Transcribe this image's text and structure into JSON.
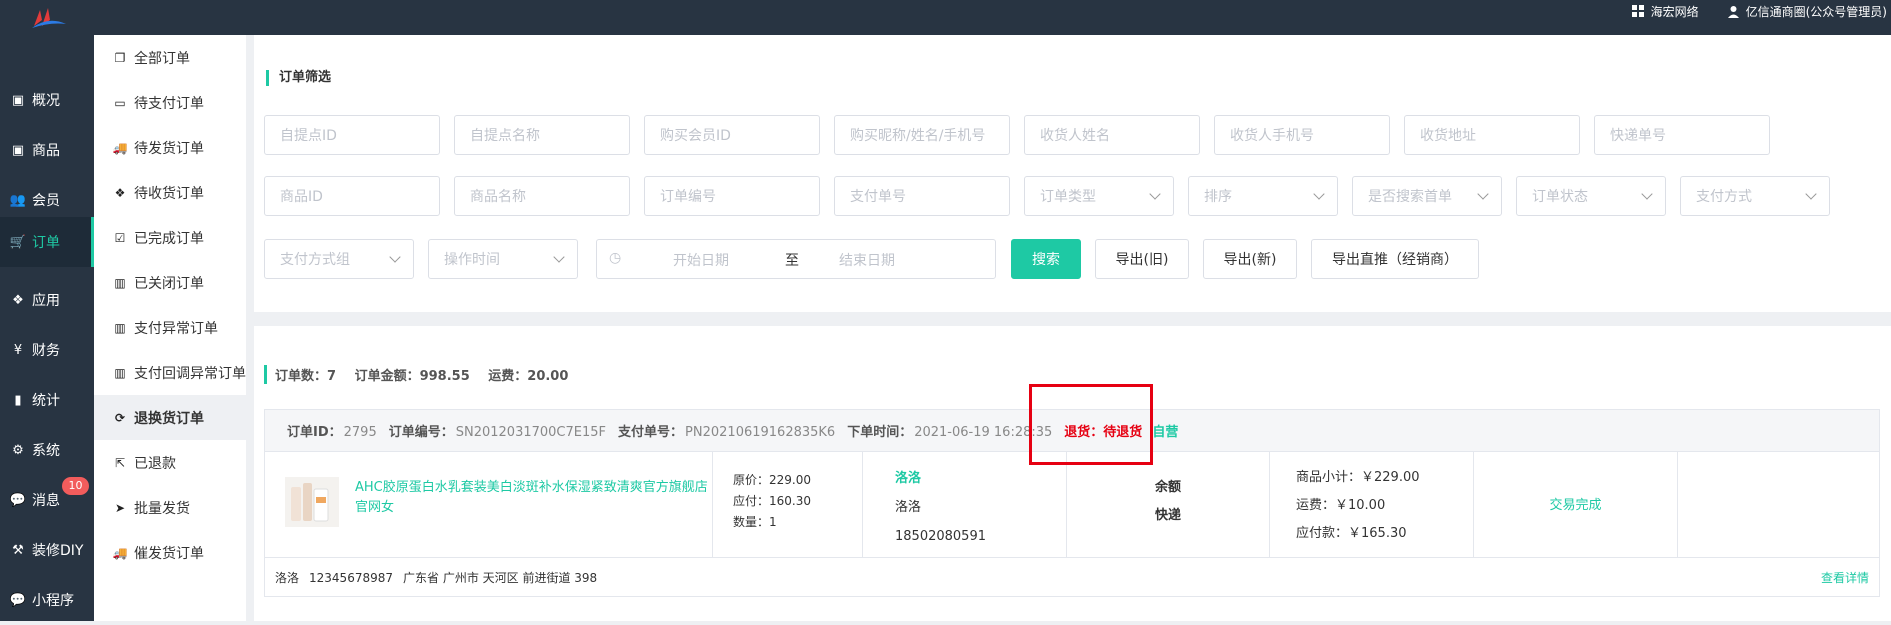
{
  "header": {
    "org": "海宏网络",
    "user": "亿信通商圈(公众号管理员)"
  },
  "main_nav": [
    {
      "label": "概况",
      "icon": "overview-icon"
    },
    {
      "label": "商品",
      "icon": "goods-icon"
    },
    {
      "label": "会员",
      "icon": "members-icon"
    },
    {
      "label": "订单",
      "icon": "cart-icon",
      "active": true
    },
    {
      "label": "应用",
      "icon": "apps-icon"
    },
    {
      "label": "财务",
      "icon": "yen-icon"
    },
    {
      "label": "统计",
      "icon": "chart-icon"
    },
    {
      "label": "系统",
      "icon": "gear-icon"
    },
    {
      "label": "消息",
      "icon": "message-icon",
      "badge": "10"
    },
    {
      "label": "装修DIY",
      "icon": "hammer-icon"
    },
    {
      "label": "小程序",
      "icon": "wechat-icon"
    }
  ],
  "sub_nav": [
    {
      "label": "全部订单"
    },
    {
      "label": "待支付订单"
    },
    {
      "label": "待发货订单"
    },
    {
      "label": "待收货订单"
    },
    {
      "label": "已完成订单"
    },
    {
      "label": "已关闭订单"
    },
    {
      "label": "支付异常订单"
    },
    {
      "label": "支付回调异常订单"
    },
    {
      "label": "退换货订单",
      "active": true
    },
    {
      "label": "已退款"
    },
    {
      "label": "批量发货"
    },
    {
      "label": "催发货订单"
    }
  ],
  "filter": {
    "title": "订单筛选",
    "row1": [
      "自提点ID",
      "自提点名称",
      "购买会员ID",
      "购买昵称/姓名/手机号",
      "收货人姓名",
      "收货人手机号",
      "收货地址",
      "快递单号"
    ],
    "row2_inputs": [
      "商品ID",
      "商品名称",
      "订单编号",
      "支付单号"
    ],
    "row2_selects": [
      "订单类型",
      "排序",
      "是否搜索首单",
      "订单状态",
      "支付方式"
    ],
    "row3_selects": [
      "支付方式组",
      "操作时间"
    ],
    "date_start": "开始日期",
    "date_sep": "至",
    "date_end": "结束日期",
    "btn_search": "搜索",
    "btn_export_old": "导出(旧)",
    "btn_export_new": "导出(新)",
    "btn_export_direct": "导出直推（经销商）"
  },
  "summary": {
    "count": "订单数：7",
    "amount": "订单金额：998.55",
    "freight": "运费：20.00"
  },
  "order": {
    "id_label": "订单ID：",
    "id": "2795",
    "sn_label": "订单编号：",
    "sn": "SN2012031700C7E15F",
    "pay_label": "支付单号：",
    "pay_no": "PN20210619162835K6",
    "time_label": "下单时间：",
    "time": "2021-06-19 16:28:35",
    "refund_status": "退货：待退货",
    "shop_type": "自营",
    "product_title": "AHC胶原蛋白水乳套装美白淡斑补水保湿紧致清爽官方旗舰店官网女",
    "orig_price": "原价：229.00",
    "pay_price": "应付：160.30",
    "quantity": "数量：1",
    "buyer_link": "洛洛",
    "buyer_name": "洛洛",
    "buyer_phone": "18502080591",
    "pay_method": "余额",
    "delivery": "快递",
    "subtotal": "商品小计：￥229.00",
    "freight": "运费：￥10.00",
    "payable": "应付款：￥165.30",
    "status": "交易完成",
    "recv_name": "洛洛",
    "recv_phone": "12345678987",
    "recv_addr": "广东省 广州市 天河区 前进街道 398",
    "detail_link": "查看详情"
  },
  "colors": {
    "accent": "#1ec9a4",
    "sidebar": "#283442",
    "highlight_red": "#e60012"
  }
}
